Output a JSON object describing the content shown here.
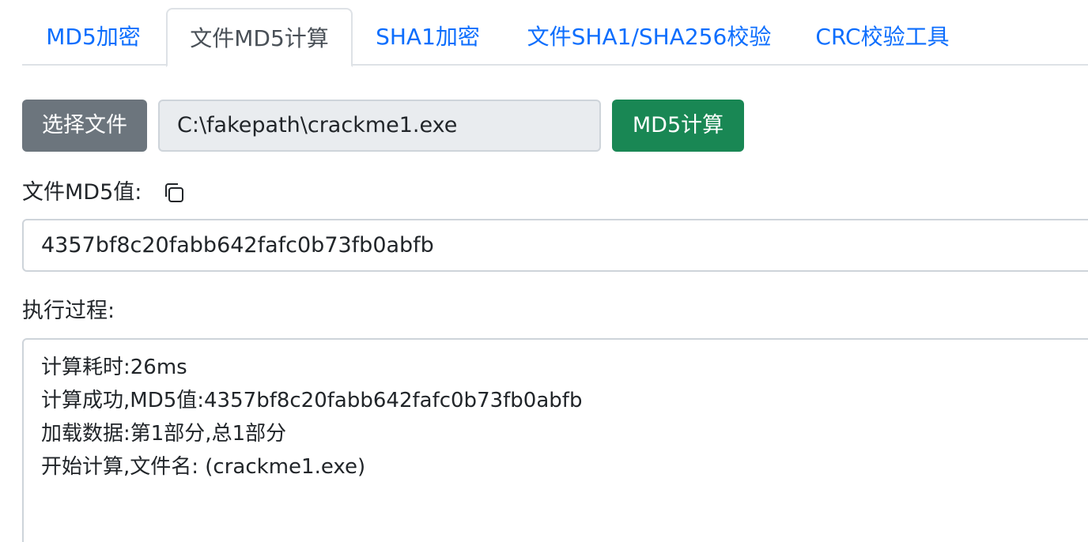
{
  "tabs": [
    {
      "label": "MD5加密",
      "active": false
    },
    {
      "label": "文件MD5计算",
      "active": true
    },
    {
      "label": "SHA1加密",
      "active": false
    },
    {
      "label": "文件SHA1/SHA256校验",
      "active": false
    },
    {
      "label": "CRC校验工具",
      "active": false
    }
  ],
  "file_picker": {
    "choose_button": "选择文件",
    "file_path": "C:\\fakepath\\crackme1.exe",
    "compute_button": "MD5计算"
  },
  "result": {
    "label": "文件MD5值:",
    "value": "4357bf8c20fabb642fafc0b73fb0abfb",
    "copy_icon": "copy-icon"
  },
  "process": {
    "label": "执行过程:",
    "lines": [
      "计算耗时:26ms",
      "计算成功,MD5值:4357bf8c20fabb642fafc0b73fb0abfb",
      "加载数据:第1部分,总1部分",
      "开始计算,文件名: (crackme1.exe)"
    ]
  },
  "colors": {
    "link": "#0d6efd",
    "secondary": "#6c757d",
    "success": "#198754",
    "border": "#dee2e6"
  }
}
